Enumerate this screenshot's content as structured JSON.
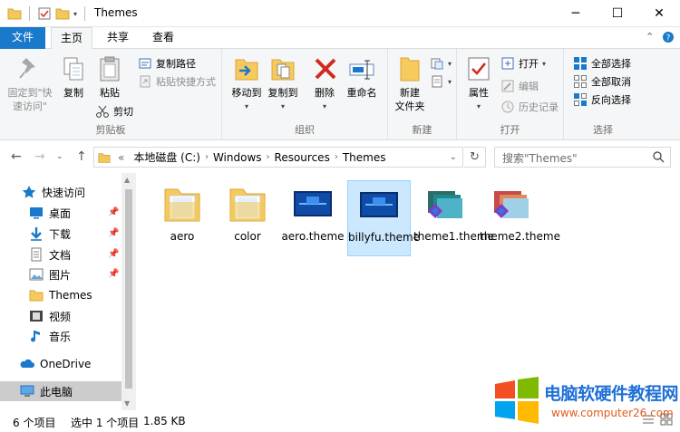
{
  "window": {
    "title": "Themes"
  },
  "ribbon_tabs": {
    "file": "文件",
    "home": "主页",
    "share": "共享",
    "view": "查看"
  },
  "ribbon": {
    "clipboard": {
      "pin": "固定到\"快速访问\"",
      "copy": "复制",
      "paste": "粘贴",
      "copy_path": "复制路径",
      "paste_shortcut": "粘贴快捷方式",
      "cut": "剪切",
      "label": "剪贴板"
    },
    "organize": {
      "move_to": "移动到",
      "copy_to": "复制到",
      "delete": "删除",
      "rename": "重命名",
      "label": "组织"
    },
    "new": {
      "new_folder": "新建\n文件夹",
      "label": "新建"
    },
    "open": {
      "properties": "属性",
      "open": "打开",
      "edit": "编辑",
      "history": "历史记录",
      "label": "打开"
    },
    "select": {
      "select_all": "全部选择",
      "select_none": "全部取消",
      "invert": "反向选择",
      "label": "选择"
    }
  },
  "address": {
    "prefix": "«",
    "segments": [
      "本地磁盘 (C:)",
      "Windows",
      "Resources",
      "Themes"
    ]
  },
  "search": {
    "placeholder": "搜索\"Themes\""
  },
  "nav": {
    "quick_access": "快速访问",
    "desktop": "桌面",
    "downloads": "下载",
    "documents": "文档",
    "pictures": "图片",
    "themes": "Themes",
    "videos": "视频",
    "music": "音乐",
    "onedrive": "OneDrive",
    "this_pc": "此电脑"
  },
  "files": [
    {
      "name": "aero",
      "type": "folder"
    },
    {
      "name": "color",
      "type": "folder"
    },
    {
      "name": "aero.theme",
      "type": "theme-blue"
    },
    {
      "name": "billyfu.theme",
      "type": "theme-blue",
      "selected": true
    },
    {
      "name": "theme1.theme",
      "type": "theme-pack"
    },
    {
      "name": "theme2.theme",
      "type": "theme-pack"
    }
  ],
  "status": {
    "count": "6 个项目",
    "selected": "选中 1 个项目",
    "size": "1.85 KB"
  },
  "watermark": {
    "text": "电脑软硬件教程网",
    "url": "www.computer26.com"
  }
}
